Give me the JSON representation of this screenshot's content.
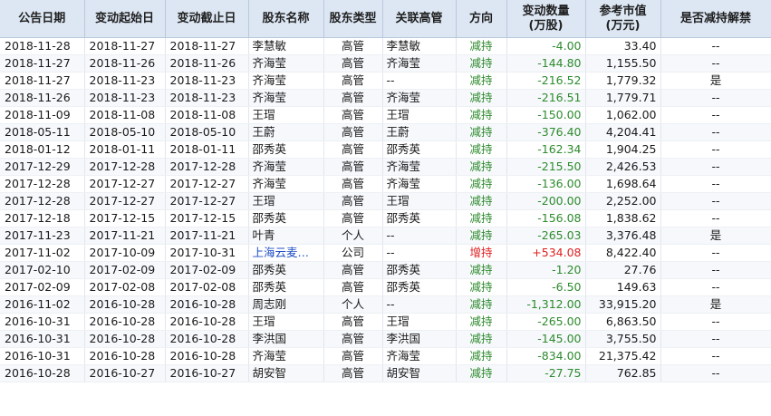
{
  "table": {
    "headers": [
      {
        "line1": "公告日期",
        "line2": ""
      },
      {
        "line1": "变动起始日",
        "line2": ""
      },
      {
        "line1": "变动截止日",
        "line2": ""
      },
      {
        "line1": "股东名称",
        "line2": ""
      },
      {
        "line1": "股东类型",
        "line2": ""
      },
      {
        "line1": "关联高管",
        "line2": ""
      },
      {
        "line1": "方向",
        "line2": ""
      },
      {
        "line1": "变动数量",
        "line2": "(万股)"
      },
      {
        "line1": "参考市值",
        "line2": "(万元)"
      },
      {
        "line1": "是否减持解禁",
        "line2": ""
      }
    ],
    "rows": [
      {
        "announce": "2018-11-28",
        "start": "2018-11-27",
        "end": "2018-11-27",
        "holder": "李慧敏",
        "type": "高管",
        "exec": "李慧敏",
        "direction": "减持",
        "change": "-4.00",
        "value": "33.40",
        "unlock": "--"
      },
      {
        "announce": "2018-11-27",
        "start": "2018-11-26",
        "end": "2018-11-26",
        "holder": "齐海莹",
        "type": "高管",
        "exec": "齐海莹",
        "direction": "减持",
        "change": "-144.80",
        "value": "1,155.50",
        "unlock": "--"
      },
      {
        "announce": "2018-11-27",
        "start": "2018-11-23",
        "end": "2018-11-23",
        "holder": "齐海莹",
        "type": "高管",
        "exec": "--",
        "direction": "减持",
        "change": "-216.52",
        "value": "1,779.32",
        "unlock": "是"
      },
      {
        "announce": "2018-11-26",
        "start": "2018-11-23",
        "end": "2018-11-23",
        "holder": "齐海莹",
        "type": "高管",
        "exec": "齐海莹",
        "direction": "减持",
        "change": "-216.51",
        "value": "1,779.71",
        "unlock": "--"
      },
      {
        "announce": "2018-11-09",
        "start": "2018-11-08",
        "end": "2018-11-08",
        "holder": "王瑁",
        "type": "高管",
        "exec": "王瑁",
        "direction": "减持",
        "change": "-150.00",
        "value": "1,062.00",
        "unlock": "--"
      },
      {
        "announce": "2018-05-11",
        "start": "2018-05-10",
        "end": "2018-05-10",
        "holder": "王蔚",
        "type": "高管",
        "exec": "王蔚",
        "direction": "减持",
        "change": "-376.40",
        "value": "4,204.41",
        "unlock": "--"
      },
      {
        "announce": "2018-01-12",
        "start": "2018-01-11",
        "end": "2018-01-11",
        "holder": "邵秀英",
        "type": "高管",
        "exec": "邵秀英",
        "direction": "减持",
        "change": "-162.34",
        "value": "1,904.25",
        "unlock": "--"
      },
      {
        "announce": "2017-12-29",
        "start": "2017-12-28",
        "end": "2017-12-28",
        "holder": "齐海莹",
        "type": "高管",
        "exec": "齐海莹",
        "direction": "减持",
        "change": "-215.50",
        "value": "2,426.53",
        "unlock": "--"
      },
      {
        "announce": "2017-12-28",
        "start": "2017-12-27",
        "end": "2017-12-27",
        "holder": "齐海莹",
        "type": "高管",
        "exec": "齐海莹",
        "direction": "减持",
        "change": "-136.00",
        "value": "1,698.64",
        "unlock": "--"
      },
      {
        "announce": "2017-12-28",
        "start": "2017-12-27",
        "end": "2017-12-27",
        "holder": "王瑁",
        "type": "高管",
        "exec": "王瑁",
        "direction": "减持",
        "change": "-200.00",
        "value": "2,252.00",
        "unlock": "--"
      },
      {
        "announce": "2017-12-18",
        "start": "2017-12-15",
        "end": "2017-12-15",
        "holder": "邵秀英",
        "type": "高管",
        "exec": "邵秀英",
        "direction": "减持",
        "change": "-156.08",
        "value": "1,838.62",
        "unlock": "--"
      },
      {
        "announce": "2017-11-23",
        "start": "2017-11-21",
        "end": "2017-11-21",
        "holder": "叶青",
        "type": "个人",
        "exec": "--",
        "direction": "减持",
        "change": "-265.03",
        "value": "3,376.48",
        "unlock": "是"
      },
      {
        "announce": "2017-11-02",
        "start": "2017-10-09",
        "end": "2017-10-31",
        "holder": "上海云麦投...",
        "type": "公司",
        "exec": "--",
        "direction": "增持",
        "change": "+534.08",
        "value": "8,422.40",
        "unlock": "--"
      },
      {
        "announce": "2017-02-10",
        "start": "2017-02-09",
        "end": "2017-02-09",
        "holder": "邵秀英",
        "type": "高管",
        "exec": "邵秀英",
        "direction": "减持",
        "change": "-1.20",
        "value": "27.76",
        "unlock": "--"
      },
      {
        "announce": "2017-02-09",
        "start": "2017-02-08",
        "end": "2017-02-08",
        "holder": "邵秀英",
        "type": "高管",
        "exec": "邵秀英",
        "direction": "减持",
        "change": "-6.50",
        "value": "149.63",
        "unlock": "--"
      },
      {
        "announce": "2016-11-02",
        "start": "2016-10-28",
        "end": "2016-10-28",
        "holder": "周志刚",
        "type": "个人",
        "exec": "--",
        "direction": "减持",
        "change": "-1,312.00",
        "value": "33,915.20",
        "unlock": "是"
      },
      {
        "announce": "2016-10-31",
        "start": "2016-10-28",
        "end": "2016-10-28",
        "holder": "王瑁",
        "type": "高管",
        "exec": "王瑁",
        "direction": "减持",
        "change": "-265.00",
        "value": "6,863.50",
        "unlock": "--"
      },
      {
        "announce": "2016-10-31",
        "start": "2016-10-28",
        "end": "2016-10-28",
        "holder": "李洪国",
        "type": "高管",
        "exec": "李洪国",
        "direction": "减持",
        "change": "-145.00",
        "value": "3,755.50",
        "unlock": "--"
      },
      {
        "announce": "2016-10-31",
        "start": "2016-10-28",
        "end": "2016-10-28",
        "holder": "齐海莹",
        "type": "高管",
        "exec": "齐海莹",
        "direction": "减持",
        "change": "-834.00",
        "value": "21,375.42",
        "unlock": "--"
      },
      {
        "announce": "2016-10-28",
        "start": "2016-10-27",
        "end": "2016-10-27",
        "holder": "胡安智",
        "type": "高管",
        "exec": "胡安智",
        "direction": "减持",
        "change": "-27.75",
        "value": "762.85",
        "unlock": "--"
      }
    ]
  },
  "colors": {
    "header_bg": "#dde7f4",
    "reduce": "#2e8b2e",
    "increase": "#e02020",
    "link": "#1f4fc4"
  }
}
